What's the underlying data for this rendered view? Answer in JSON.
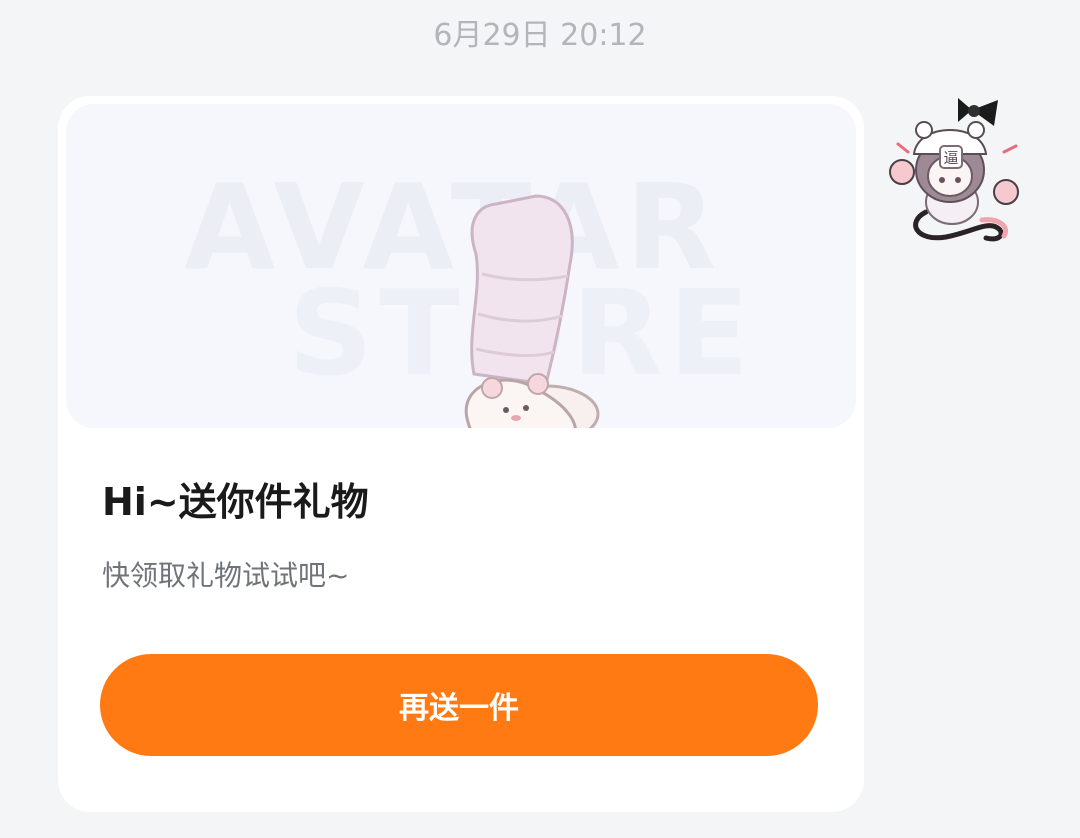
{
  "timestamp": "6月29日 20:12",
  "gift_card": {
    "image_alt": "gift-slippers-socks",
    "watermark_line1": "AVATAR",
    "watermark_line2": "STORE",
    "title": "Hi~送你件礼物",
    "subtitle": "快领取礼物试试吧~",
    "button_label": "再送一件"
  },
  "avatar": {
    "name": "user-avatar",
    "badge_text": "逼"
  },
  "colors": {
    "background": "#f4f5f7",
    "card": "#ffffff",
    "accent": "#ff7a12",
    "title": "#1a1a1a",
    "subtitle": "#707378",
    "timestamp": "#b3b5b9"
  }
}
